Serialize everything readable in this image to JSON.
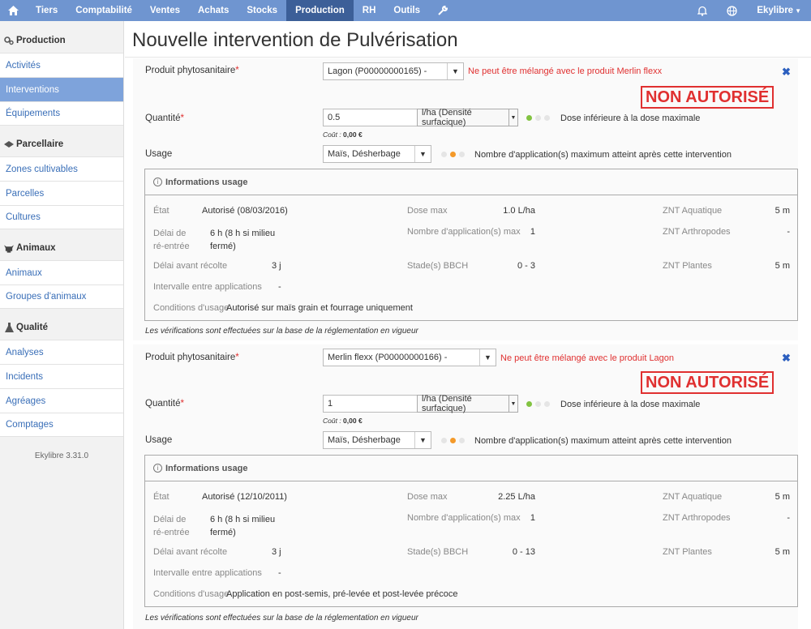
{
  "nav": {
    "items": [
      "Tiers",
      "Comptabilité",
      "Ventes",
      "Achats",
      "Stocks",
      "Production",
      "RH",
      "Outils"
    ],
    "active": "Production",
    "user": "Ekylibre"
  },
  "sidebar": {
    "sections": [
      {
        "title": "Production",
        "icon": "gears-icon",
        "items": [
          "Activités",
          "Interventions",
          "Équipements"
        ]
      },
      {
        "title": "Parcellaire",
        "icon": "parcel-icon",
        "items": [
          "Zones cultivables",
          "Parcelles",
          "Cultures"
        ]
      },
      {
        "title": "Animaux",
        "icon": "cow-icon",
        "items": [
          "Animaux",
          "Groupes d'animaux"
        ]
      },
      {
        "title": "Qualité",
        "icon": "flask-icon",
        "items": [
          "Analyses",
          "Incidents",
          "Agréages",
          "Comptages"
        ]
      }
    ],
    "active_item": "Interventions",
    "version": "Ekylibre 3.31.0"
  },
  "page": {
    "title": "Nouvelle intervention de Pulvérisation"
  },
  "labels": {
    "product": "Produit phytosanitaire",
    "quantity": "Quantité",
    "usage": "Usage",
    "cost": "Coût : ",
    "info_title": "Informations usage",
    "state": "État",
    "reentry": "Délai de ré-entrée",
    "before_harvest": "Délai avant récolte",
    "interval": "Intervalle entre applications",
    "conditions": "Conditions d'usage",
    "dose_max": "Dose max",
    "applications_max": "Nombre d'application(s) max",
    "bbch": "Stade(s) BBCH",
    "znt_aquatic": "ZNT Aquatique",
    "znt_arthropods": "ZNT Arthropodes",
    "znt_plants": "ZNT Plantes",
    "verification": "Les vérifications sont effectuées sur la base de la réglementation en vigueur",
    "not_allowed": "NON AUTORISÉ",
    "dose_message": "Dose inférieure à la dose maximale",
    "applications_message": "Nombre d'application(s) maximum atteint après cette intervention"
  },
  "products": [
    {
      "product": "Lagon (P00000000165) -",
      "warning": "Ne peut être mélangé avec le produit Merlin flexx",
      "quantity": "0.5",
      "unit": "l/ha (Densité surfacique)",
      "cost": "0,00 €",
      "usage": "Maïs, Désherbage",
      "state": "Autorisé (08/03/2016)",
      "reentry": "6 h (8 h si milieu fermé)",
      "before_harvest": "3 j",
      "interval": "-",
      "conditions": "Autorisé sur maïs grain et fourrage uniquement",
      "dose_max": "1.0 L/ha",
      "applications_max": "1",
      "bbch": "0 - 3",
      "znt_aquatic": "5 m",
      "znt_arthropods": "-",
      "znt_plants": "5 m"
    },
    {
      "product": "Merlin flexx (P00000000166) -",
      "warning": "Ne peut être mélangé avec le produit Lagon",
      "quantity": "1",
      "unit": "l/ha (Densité surfacique)",
      "cost": "0,00 €",
      "usage": "Maïs, Désherbage",
      "state": "Autorisé (12/10/2011)",
      "reentry": "6 h (8 h si milieu fermé)",
      "before_harvest": "3 j",
      "interval": "-",
      "conditions": "Application en post-semis, pré-levée et post-levée précoce",
      "dose_max": "2.25 L/ha",
      "applications_max": "1",
      "bbch": "0 - 13",
      "znt_aquatic": "5 m",
      "znt_arthropods": "-",
      "znt_plants": "5 m"
    }
  ]
}
